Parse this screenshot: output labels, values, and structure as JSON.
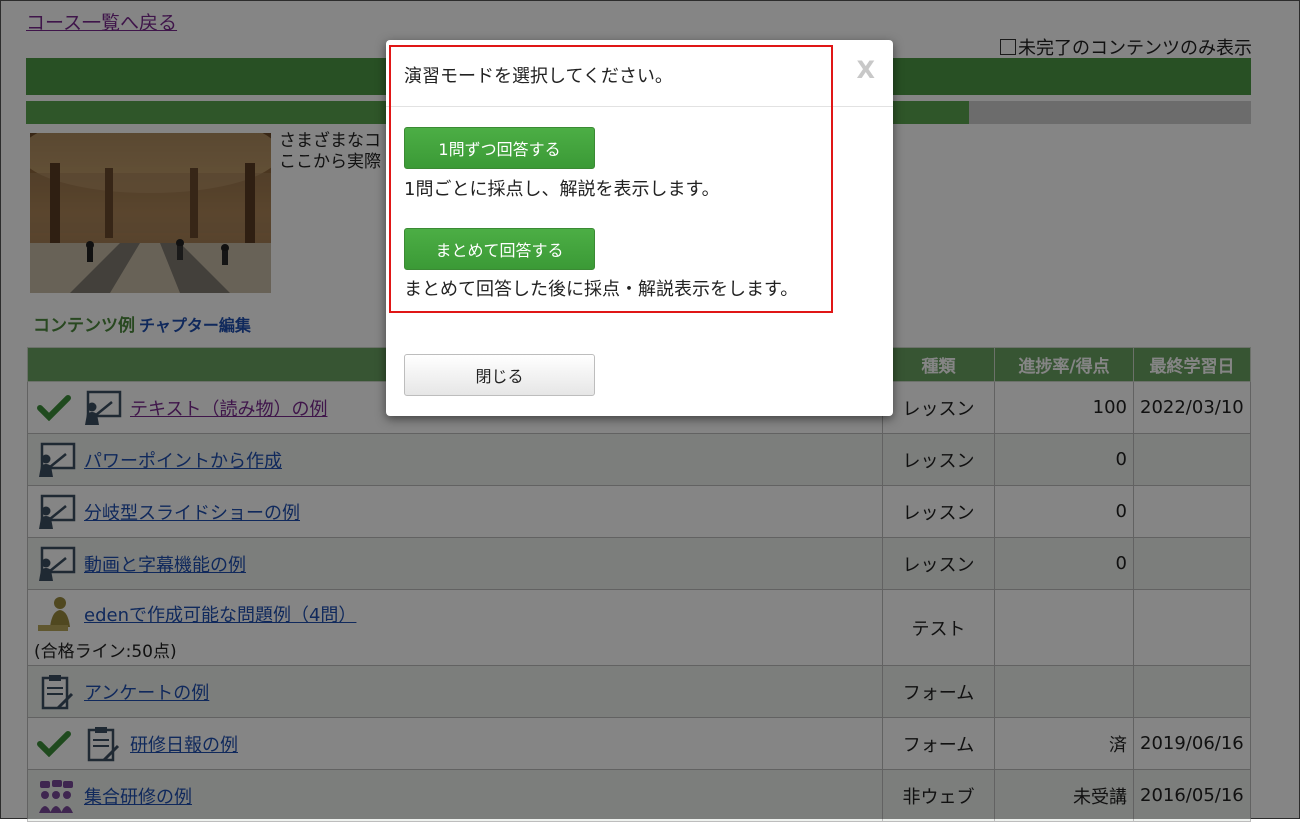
{
  "back_link": "コース一覧へ戻る",
  "filter_label": "未完了のコンテンツのみ表示",
  "progress_fraction": 0.77,
  "description": {
    "line1": "さまざまなコ",
    "line2": "ここから実際"
  },
  "section": {
    "title": "コンテンツ例",
    "edit_link": "チャプター編集"
  },
  "table": {
    "headers": {
      "type": "種類",
      "progress": "進捗率/得点",
      "last_date": "最終学習日"
    },
    "rows": [
      {
        "title": "テキスト（読み物）の例",
        "type": "レッスン",
        "progress": "100",
        "date": "2022/03/10",
        "done": true,
        "icon": "lecture-icon"
      },
      {
        "title": "パワーポイントから作成",
        "type": "レッスン",
        "progress": "0",
        "date": "",
        "done": false,
        "icon": "lecture-icon"
      },
      {
        "title": "分岐型スライドショーの例",
        "type": "レッスン",
        "progress": "0",
        "date": "",
        "done": false,
        "icon": "lecture-icon"
      },
      {
        "title": "動画と字幕機能の例",
        "type": "レッスン",
        "progress": "0",
        "date": "",
        "done": false,
        "icon": "lecture-icon"
      },
      {
        "title": "edenで作成可能な問題例（4問）",
        "sub": "(合格ライン:50点)",
        "type": "テスト",
        "progress": "",
        "date": "",
        "done": false,
        "icon": "test-person-icon"
      },
      {
        "title": "アンケートの例",
        "type": "フォーム",
        "progress": "",
        "date": "",
        "done": false,
        "icon": "clipboard-icon"
      },
      {
        "title": "研修日報の例",
        "type": "フォーム",
        "progress": "済",
        "date": "2019/06/16",
        "done": true,
        "icon": "clipboard-icon"
      },
      {
        "title": "集合研修の例",
        "type": "非ウェブ",
        "progress": "未受講",
        "date": "2016/05/16",
        "done": false,
        "icon": "group-icon"
      }
    ]
  },
  "modal": {
    "title": "演習モードを選択してください。",
    "close_x": "X",
    "option1_label": "1問ずつ回答する",
    "option1_desc": "1問ごとに採点し、解説を表示します。",
    "option2_label": "まとめて回答する",
    "option2_desc": "まとめて回答した後に採点・解説表示をします。",
    "close_button": "閉じる"
  }
}
